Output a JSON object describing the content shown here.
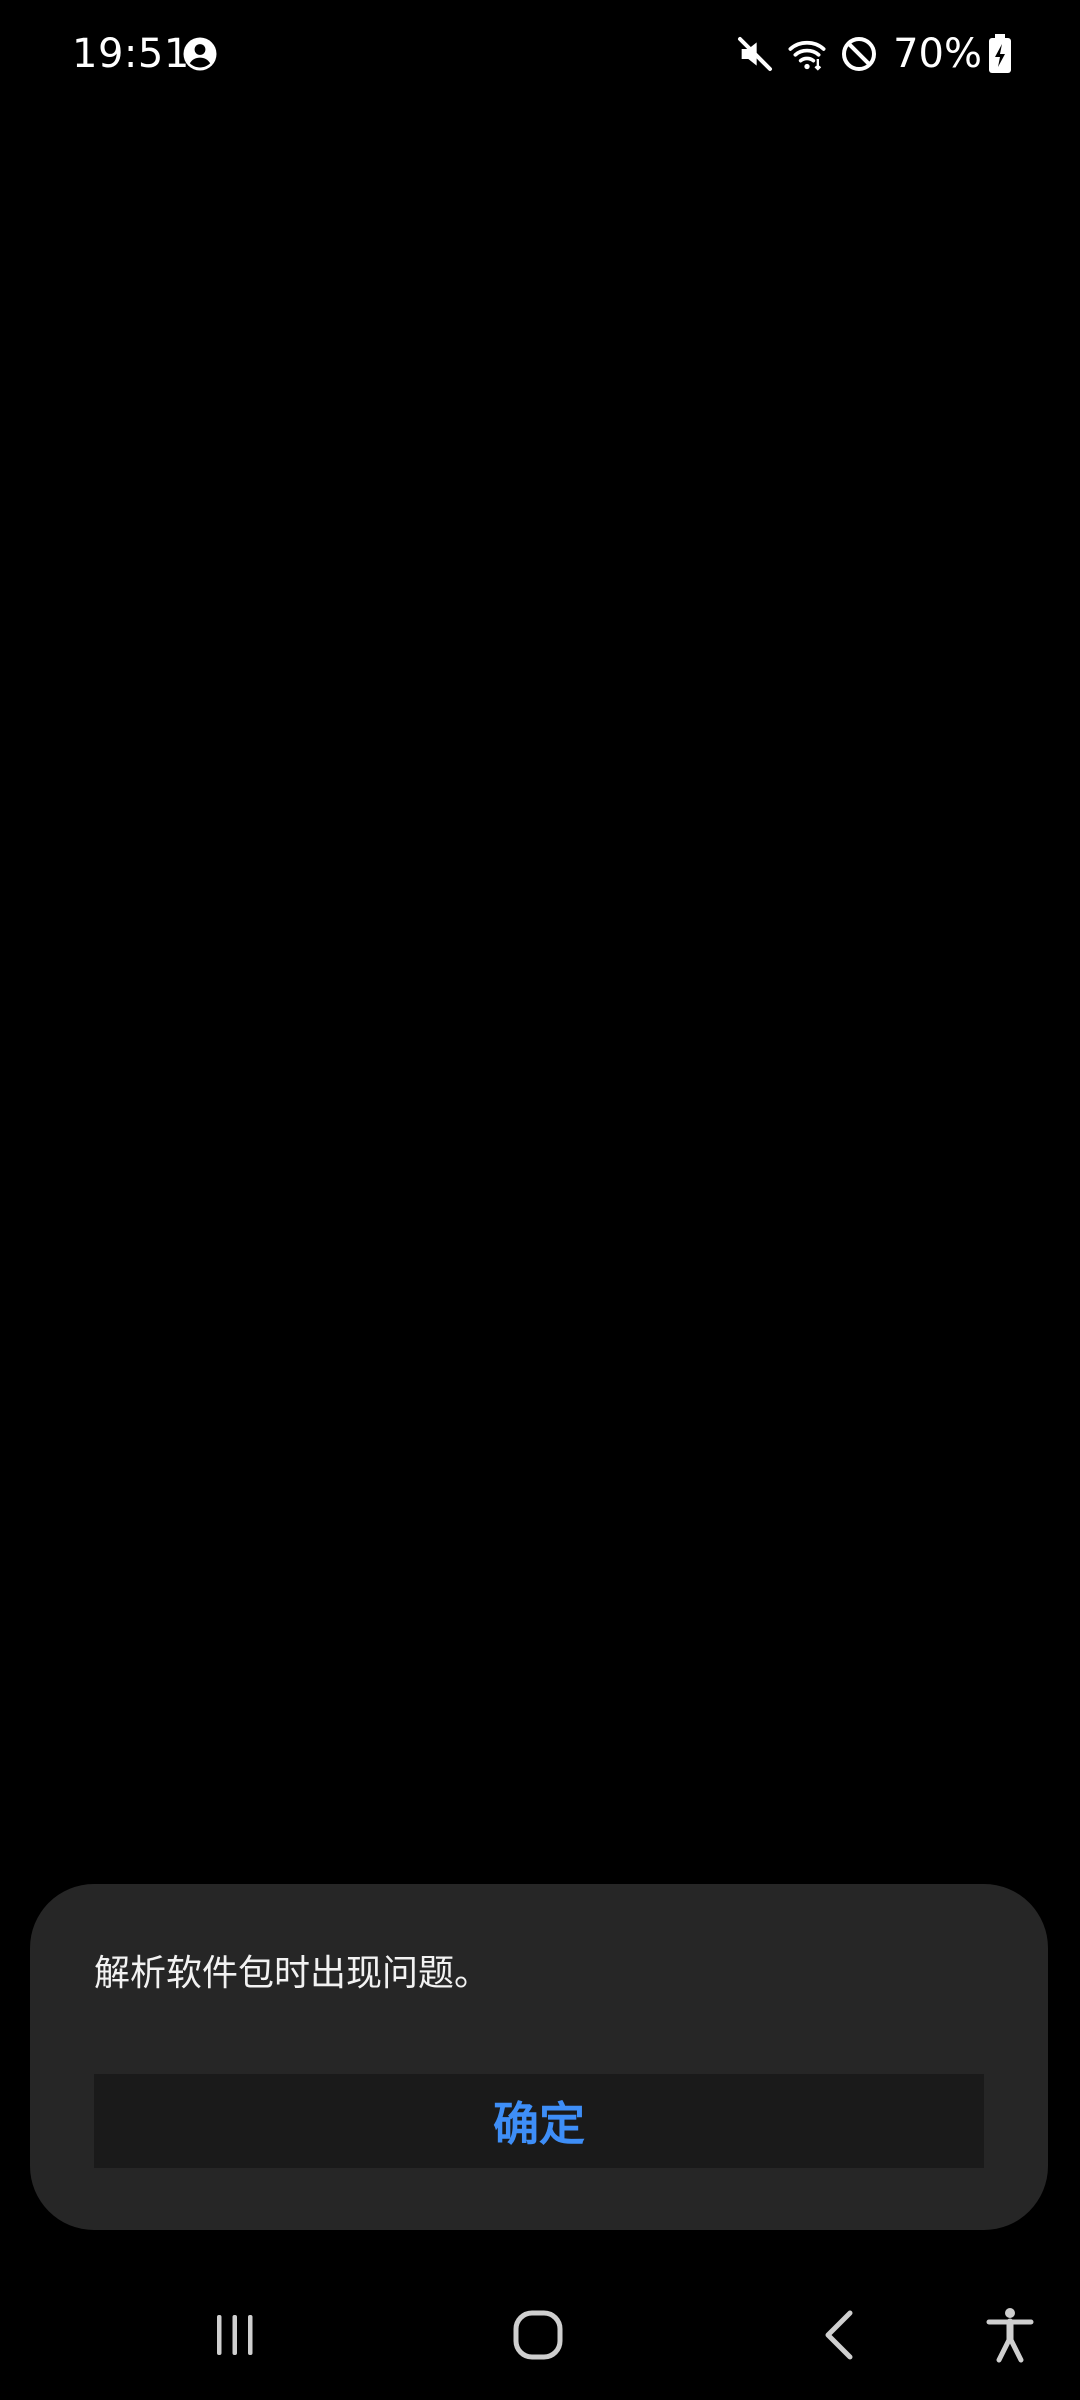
{
  "status_bar": {
    "time": "19:51",
    "battery_percent": "70%",
    "icons": [
      "account-circle-icon",
      "mute-icon",
      "wifi-icon",
      "do-not-disturb-icon",
      "battery-charging-icon"
    ]
  },
  "dialog": {
    "message": "解析软件包时出现问题。",
    "ok_label": "确定"
  },
  "nav_bar": {
    "icons": [
      "recents-icon",
      "home-icon",
      "back-icon",
      "accessibility-icon"
    ]
  },
  "colors": {
    "background": "#000000",
    "dialog_background": "#262626",
    "button_background": "#1a1a1a",
    "accent": "#3e8ef7",
    "text": "#f2f2f2"
  }
}
